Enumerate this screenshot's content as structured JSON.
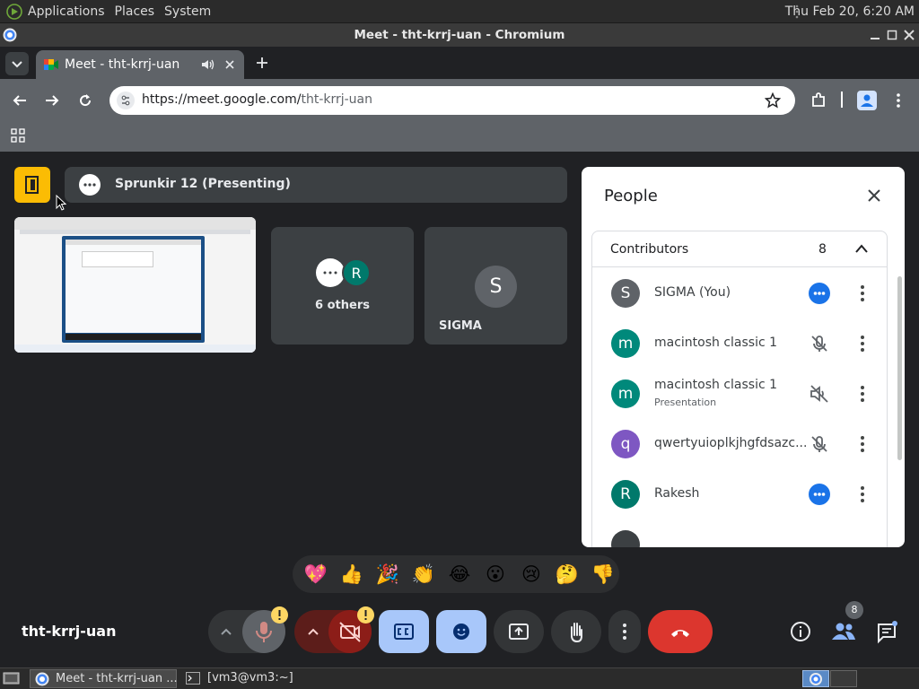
{
  "system_bar": {
    "menu": [
      "Applications",
      "Places",
      "System"
    ],
    "clock": "Thu Feb 20,  6:20 AM"
  },
  "window": {
    "title": "Meet - tht-krrj-uan - Chromium"
  },
  "browser": {
    "tab_title": "Meet - tht-krrj-uan",
    "url_domain": "https://meet.google.com/",
    "url_path": "tht-krrj-uan"
  },
  "meet": {
    "presenting_label": "Sprunkir 12 (Presenting)",
    "others_label": "6 others",
    "others_avatar_letter": "R",
    "self_tile_name": "SIGMA",
    "self_tile_letter": "S",
    "meeting_code": "tht-krrj-uan",
    "participant_badge": "8",
    "reactions": [
      "💖",
      "👍",
      "🎉",
      "👏",
      "😂",
      "😮",
      "😢",
      "🤔",
      "👎"
    ],
    "colors": {
      "accent_blue": "#1a73e8",
      "light_blue": "#8ab4f8",
      "end_call": "#ea4335",
      "dark_red": "#8c1d18",
      "warning": "#fdd663",
      "present_yellow": "#fbbc04"
    }
  },
  "people_panel": {
    "title": "People",
    "section_label": "Contributors",
    "section_count": "8",
    "participants": [
      {
        "letter": "S",
        "name": "SIGMA (You)",
        "subtitle": "",
        "color": "#5f6368",
        "status": "speaking-dots"
      },
      {
        "letter": "m",
        "name": "macintosh classic 1",
        "subtitle": "",
        "color": "#00897b",
        "status": "mic-off"
      },
      {
        "letter": "m",
        "name": "macintosh classic 1",
        "subtitle": "Presentation",
        "color": "#00897b",
        "status": "volume-off"
      },
      {
        "letter": "q",
        "name": "qwertyuioplkjhgfdsazc...",
        "subtitle": "",
        "color": "#7e57c2",
        "status": "mic-off"
      },
      {
        "letter": "R",
        "name": "Rakesh",
        "subtitle": "",
        "color": "#00796b",
        "status": "speaking-dots"
      }
    ]
  },
  "taskbar": {
    "items": [
      "Meet - tht-krrj-uan ...",
      "[vm3@vm3:~]"
    ]
  }
}
